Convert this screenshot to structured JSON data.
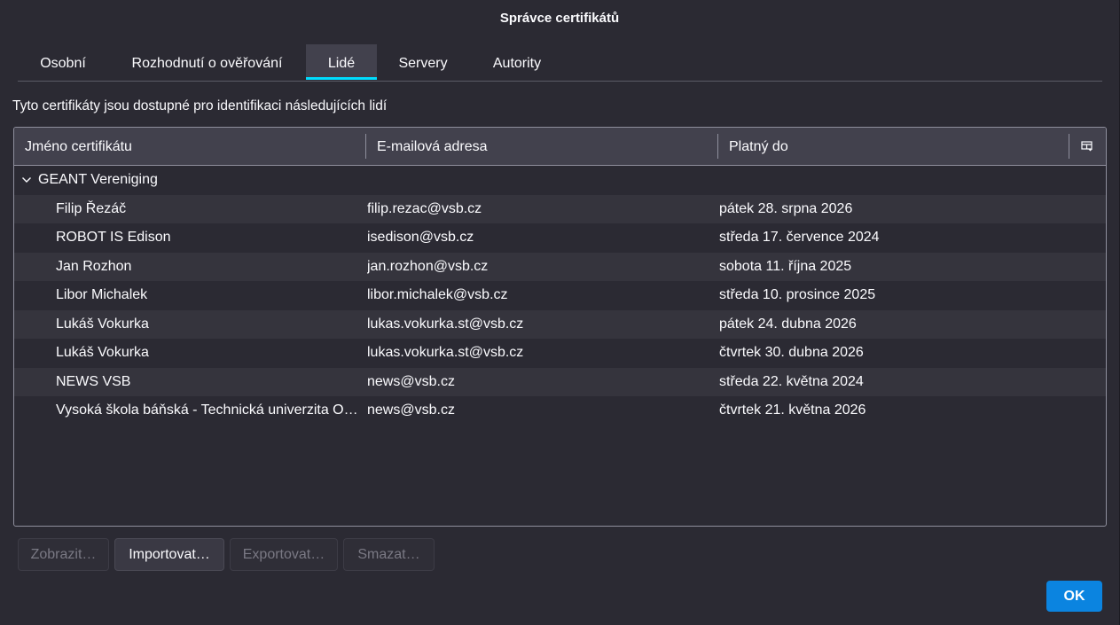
{
  "window": {
    "title": "Správce certifikátů"
  },
  "tabs": [
    {
      "label": "Osobní",
      "selected": false
    },
    {
      "label": "Rozhodnutí o ověřování",
      "selected": false
    },
    {
      "label": "Lidé",
      "selected": true
    },
    {
      "label": "Servery",
      "selected": false
    },
    {
      "label": "Autority",
      "selected": false
    }
  ],
  "description": "Tyto certifikáty jsou dostupné pro identifikaci následujících lidí",
  "columns": {
    "name": "Jméno certifikátu",
    "email": "E-mailová adresa",
    "valid": "Platný do",
    "picker_icon": "column-picker-icon"
  },
  "group": {
    "label": "GEANT Vereniging",
    "expanded": true
  },
  "rows": [
    {
      "name": "Filip Řezáč",
      "email": "filip.rezac@vsb.cz",
      "valid": "pátek 28. srpna 2026"
    },
    {
      "name": "ROBOT IS Edison",
      "email": "isedison@vsb.cz",
      "valid": "středa 17. července 2024"
    },
    {
      "name": "Jan Rozhon",
      "email": "jan.rozhon@vsb.cz",
      "valid": "sobota 11. října 2025"
    },
    {
      "name": "Libor Michalek",
      "email": "libor.michalek@vsb.cz",
      "valid": "středa 10. prosince 2025"
    },
    {
      "name": "Lukáš Vokurka",
      "email": "lukas.vokurka.st@vsb.cz",
      "valid": "pátek 24. dubna 2026"
    },
    {
      "name": "Lukáš Vokurka",
      "email": "lukas.vokurka.st@vsb.cz",
      "valid": "čtvrtek 30. dubna 2026"
    },
    {
      "name": "NEWS VSB",
      "email": "news@vsb.cz",
      "valid": "středa 22. května 2024"
    },
    {
      "name": "Vysoká škola báňská - Technická univerzita Ostrava",
      "email": "news@vsb.cz",
      "valid": "čtvrtek 21. května 2026"
    }
  ],
  "buttons": {
    "view": {
      "label": "Zobrazit…",
      "disabled": true
    },
    "import": {
      "label": "Importovat…",
      "disabled": false
    },
    "export": {
      "label": "Exportovat…",
      "disabled": true
    },
    "delete": {
      "label": "Smazat…",
      "disabled": true
    }
  },
  "ok_label": "OK",
  "colors": {
    "accent": "#0df",
    "primary_button": "#0b84e0",
    "background": "#2b2a33"
  }
}
